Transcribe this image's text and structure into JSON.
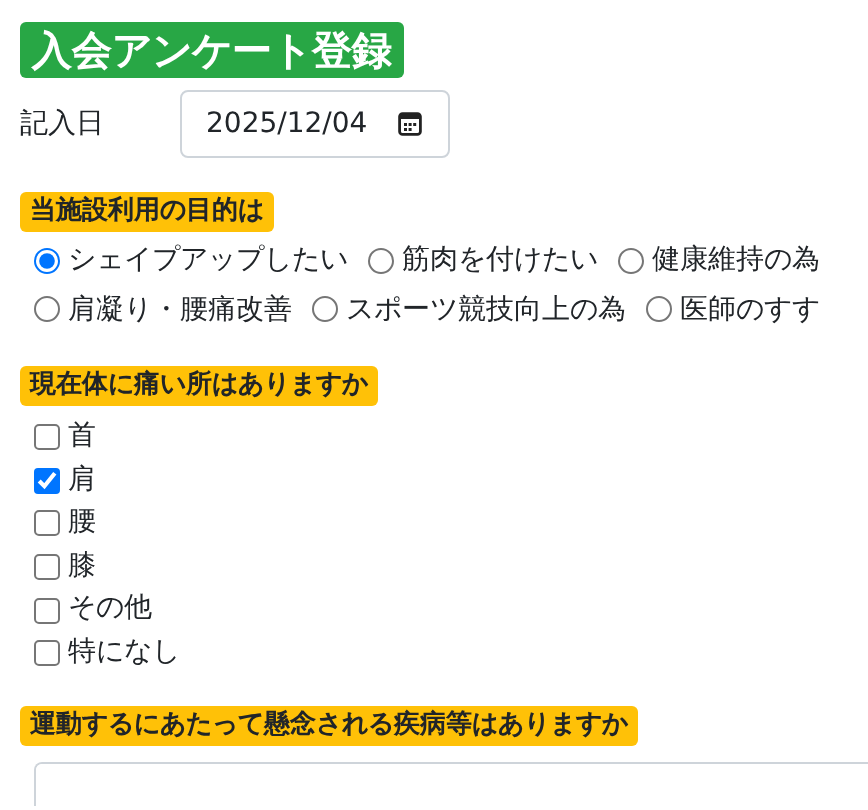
{
  "title": "入会アンケート登録",
  "date_field": {
    "label": "記入日",
    "value": "2025/12/04"
  },
  "questions": [
    {
      "kind": "radio",
      "label": "当施設利用の目的は",
      "options": [
        {
          "label": "シェイプアップしたい",
          "selected": true
        },
        {
          "label": "筋肉を付けたい",
          "selected": false
        },
        {
          "label": "健康維持の為",
          "selected": false
        },
        {
          "label": "肩凝り・腰痛改善",
          "selected": false
        },
        {
          "label": "スポーツ競技向上の為",
          "selected": false
        },
        {
          "label": "医師のすす",
          "selected": false
        }
      ]
    },
    {
      "kind": "checkbox",
      "label": "現在体に痛い所はありますか",
      "options": [
        {
          "label": "首",
          "checked": false
        },
        {
          "label": "肩",
          "checked": true
        },
        {
          "label": "腰",
          "checked": false
        },
        {
          "label": "膝",
          "checked": false
        },
        {
          "label": "その他",
          "checked": false
        },
        {
          "label": "特になし",
          "checked": false
        }
      ]
    },
    {
      "kind": "textarea",
      "label": "運動するにあたって懸念される疾病等はありますか"
    }
  ]
}
